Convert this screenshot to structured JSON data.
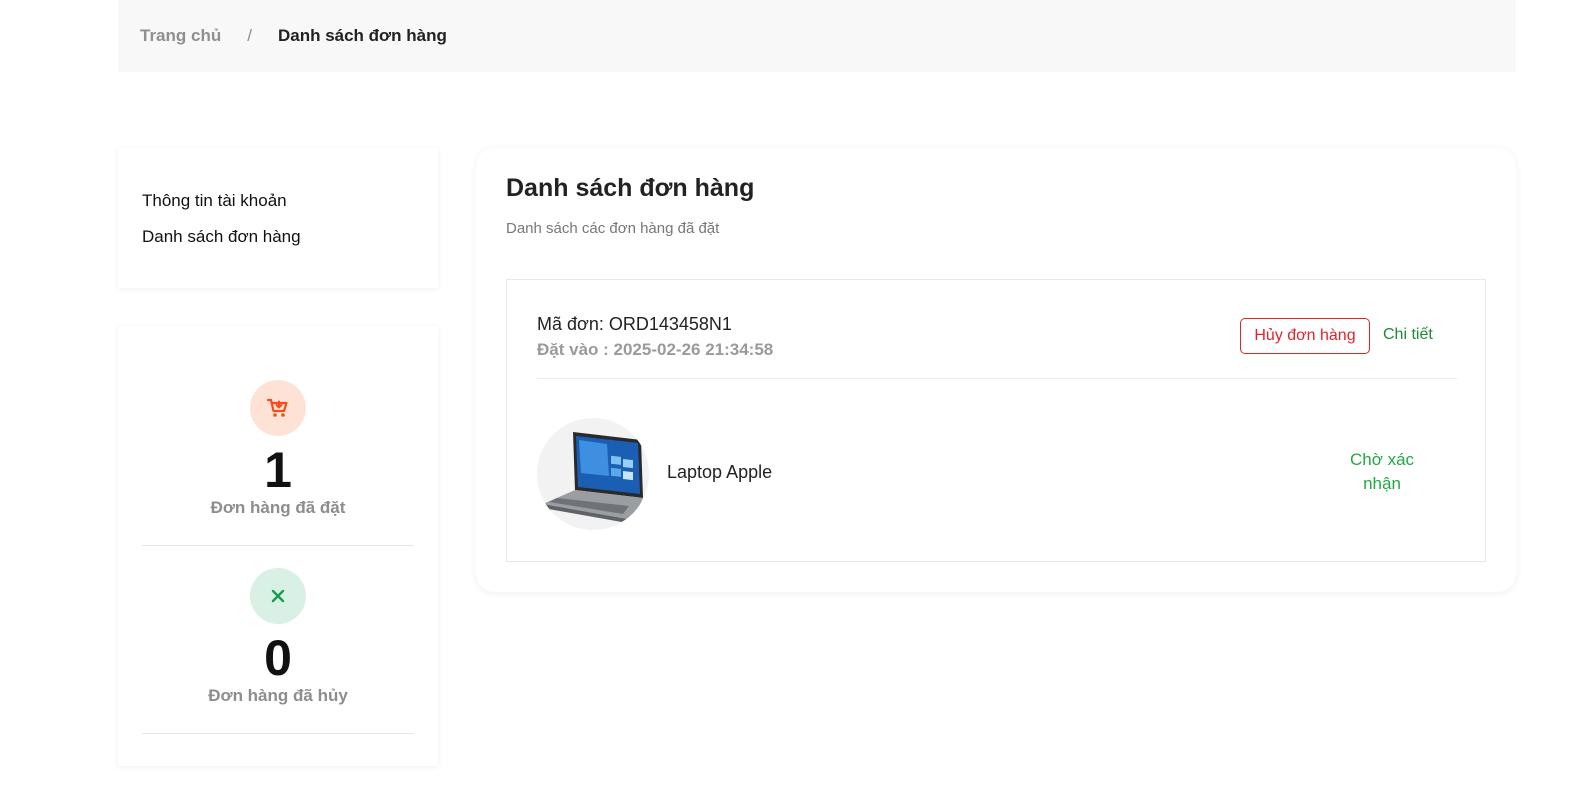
{
  "breadcrumb": {
    "home": "Trang chủ",
    "separator": "/",
    "current": "Danh sách đơn hàng"
  },
  "side_menu": {
    "items": [
      {
        "label": "Thông tin tài khoản"
      },
      {
        "label": "Danh sách đơn hàng"
      }
    ]
  },
  "stats": [
    {
      "icon": "cart-icon",
      "value": "1",
      "label": "Đơn hàng đã đặt",
      "color": "#f24e1e"
    },
    {
      "icon": "close-icon",
      "value": "0",
      "label": "Đơn hàng đã hủy",
      "color": "#1a9a4f"
    }
  ],
  "main": {
    "title": "Danh sách đơn hàng",
    "subtitle": "Danh sách các đơn hàng đã đặt",
    "orders": [
      {
        "code": "Mã đơn: ORD143458N1",
        "date": "Đặt vào : 2025-02-26 21:34:58",
        "cancel_label": "Hủy đơn hàng",
        "detail_label": "Chi tiết",
        "product_name": "Laptop Apple",
        "product_icon": "laptop-image",
        "status": "Chờ xác nhận"
      }
    ]
  },
  "colors": {
    "danger": "#e0242b",
    "success": "#22a845",
    "link": "#1e8a3a"
  }
}
